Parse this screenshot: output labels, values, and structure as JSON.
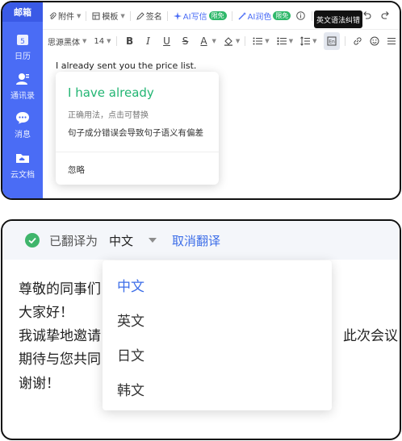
{
  "sidebar": {
    "top_label": "邮箱",
    "items": [
      {
        "label": "日历",
        "icon": "calendar-icon",
        "badge": "5"
      },
      {
        "label": "通讯录",
        "icon": "contacts-icon"
      },
      {
        "label": "消息",
        "icon": "message-icon"
      },
      {
        "label": "云文档",
        "icon": "cloud-doc-icon"
      }
    ]
  },
  "toolbar": {
    "attachment": "附件",
    "template": "模板",
    "signature": "签名",
    "ai_write": "AI写信",
    "ai_write_badge": "限免",
    "ai_polish": "AI润色",
    "ai_polish_badge": "限免"
  },
  "tooltip": "英文语法纠错",
  "format_bar": {
    "font": "思源黑体",
    "size": "14",
    "bold": "B",
    "italic": "I",
    "underline": "U",
    "strike": "S",
    "font_color": "A"
  },
  "editor": {
    "text": "I already sent you the price list."
  },
  "grammar_popover": {
    "suggestion": "I have already",
    "hint": "正确用法，点击可替换",
    "description": "句子成分错误会导致句子语义有偏差",
    "ignore": "忽略"
  },
  "translation": {
    "status_label": "已翻译为",
    "current_language": "中文",
    "cancel": "取消翻译",
    "options": [
      "中文",
      "英文",
      "日文",
      "韩文"
    ],
    "selected_index": 0
  },
  "body": {
    "line1": "尊敬的同事们",
    "line2": "大家好！",
    "line3": "我诚挚地邀请",
    "line3_right": "此次会议",
    "line4": "期待与您共同",
    "line5": "谢谢！"
  },
  "colors": {
    "sidebar_bg": "#4a6cf5",
    "accent_blue": "#3d6ee8",
    "suggestion_green": "#22b573"
  }
}
